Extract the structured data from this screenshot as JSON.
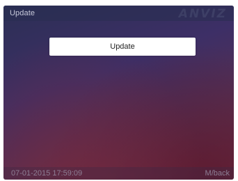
{
  "screen": {
    "title": "Update",
    "brand": "ANVIZ"
  },
  "menu": {
    "items": [
      {
        "label": "Update"
      }
    ]
  },
  "status_bar": {
    "datetime": "07-01-2015 17:59:09",
    "back_hint": "M/back"
  },
  "colors": {
    "background_top": "#2c2f55",
    "background_bottom": "#6a2c42",
    "button_bg": "#ffffff",
    "button_text": "#222222",
    "status_text": "#8e7f95"
  }
}
